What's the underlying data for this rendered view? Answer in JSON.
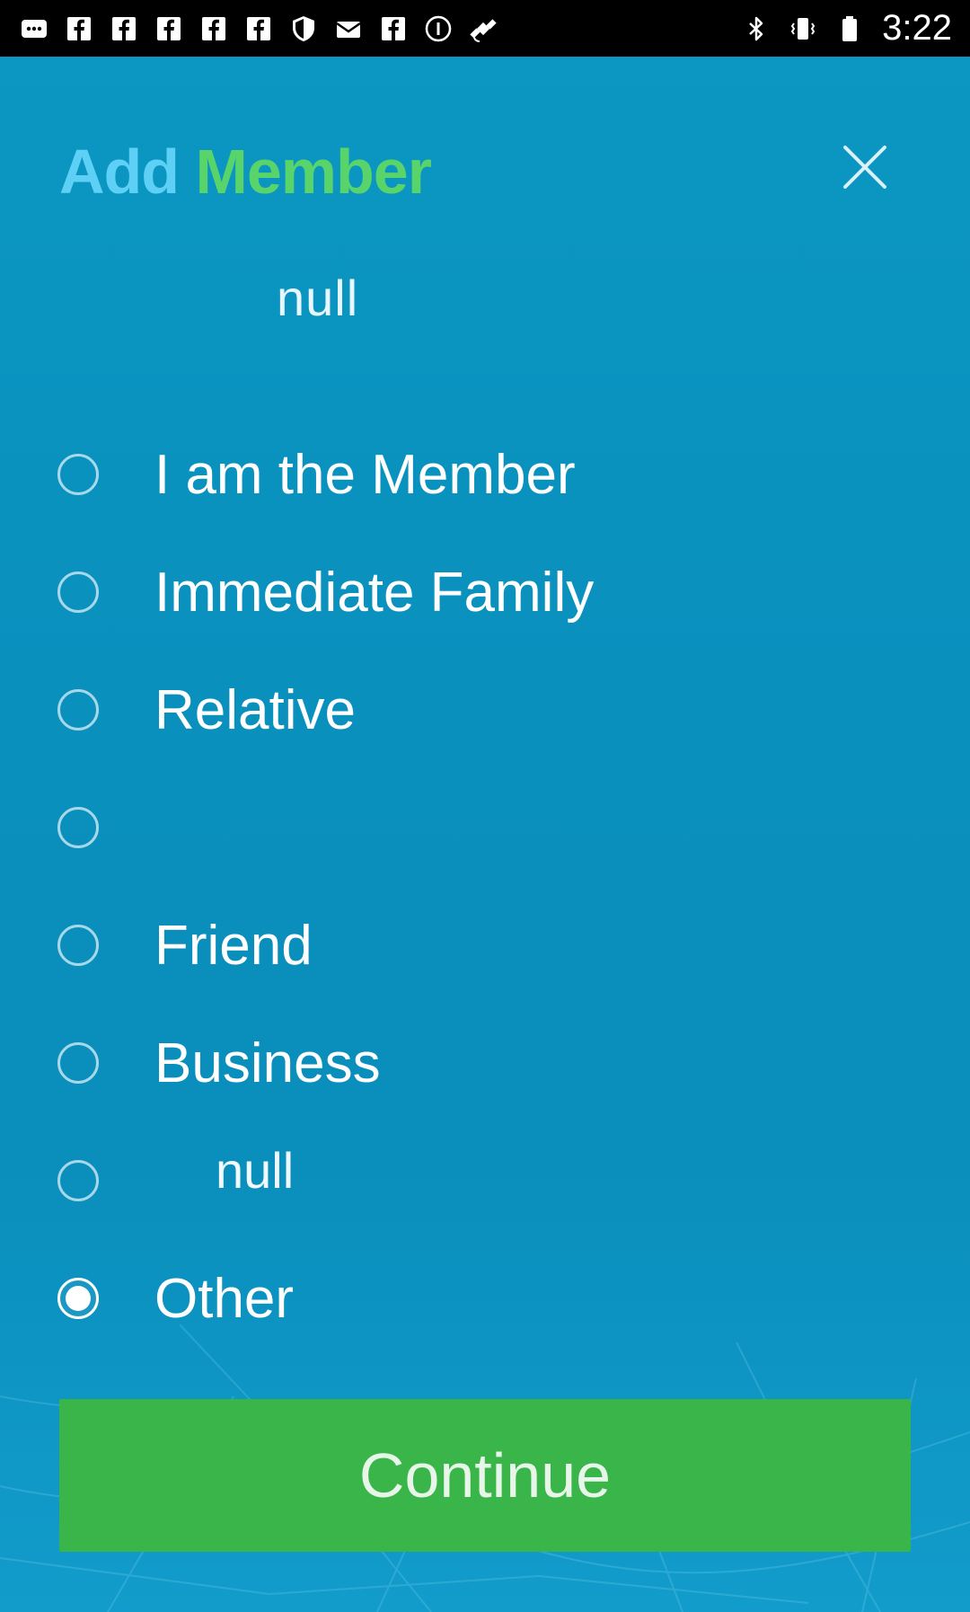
{
  "status_bar": {
    "time": "3:22",
    "left_icons": [
      "message-icon",
      "facebook-icon",
      "facebook-icon",
      "facebook-icon",
      "facebook-icon",
      "facebook-icon",
      "shield-icon",
      "mail-icon",
      "facebook-icon",
      "info-icon",
      "satellite-icon"
    ],
    "right_icons": [
      "bluetooth-icon",
      "vibrate-icon",
      "battery-icon"
    ]
  },
  "header": {
    "title_part1": "Add",
    "title_part2": "Member",
    "close_icon": "close-icon"
  },
  "subtitle": "null",
  "options": [
    {
      "label": "I am the Member",
      "checked": false
    },
    {
      "label": "Immediate Family",
      "checked": false
    },
    {
      "label": "Relative",
      "checked": false
    },
    {
      "label": "",
      "checked": false
    },
    {
      "label": "Friend",
      "checked": false
    },
    {
      "label": "Business",
      "checked": false
    },
    {
      "label": "null",
      "checked": false
    },
    {
      "label": "Other",
      "checked": true
    }
  ],
  "continue_label": "Continue",
  "colors": {
    "background": "#0a90bd",
    "title_add": "#5fd0f5",
    "title_member": "#59d46a",
    "button": "#39b54a"
  }
}
